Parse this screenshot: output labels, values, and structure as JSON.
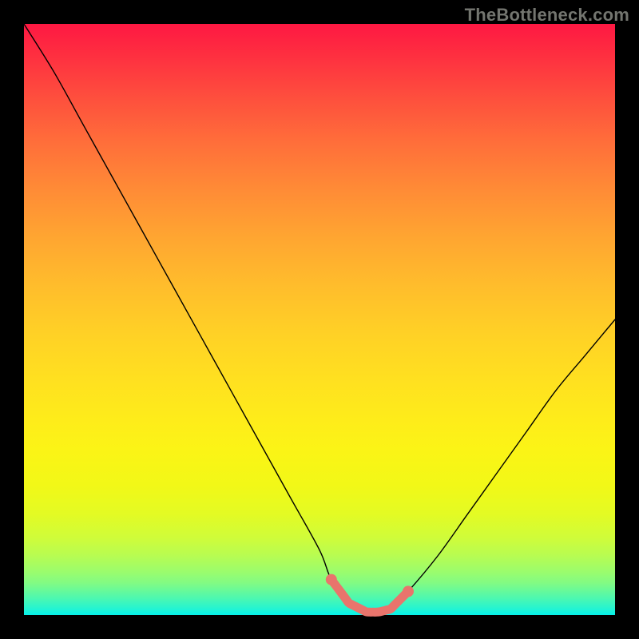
{
  "attribution": "TheBottleneck.com",
  "colors": {
    "frame": "#000000",
    "curve": "#000000",
    "accent": "#e9746c",
    "attribution_text": "#73756f"
  },
  "chart_data": {
    "type": "line",
    "title": "",
    "xlabel": "",
    "ylabel": "",
    "xlim": [
      0,
      100
    ],
    "ylim": [
      0,
      100
    ],
    "series": [
      {
        "name": "curve",
        "x": [
          0,
          5,
          10,
          15,
          20,
          25,
          30,
          35,
          40,
          45,
          50,
          52,
          55,
          58,
          60,
          62,
          65,
          70,
          75,
          80,
          85,
          90,
          95,
          100
        ],
        "values": [
          100,
          92,
          83,
          74,
          65,
          56,
          47,
          38,
          29,
          20,
          11,
          6,
          2,
          0.5,
          0.5,
          1,
          4,
          10,
          17,
          24,
          31,
          38,
          44,
          50
        ]
      }
    ],
    "accent_segment": {
      "x_start": 52,
      "x_end": 65,
      "note": "highlighted trough region near y≈0.5–4"
    },
    "gradient_background": {
      "direction": "vertical",
      "stops": [
        {
          "pos": 0.0,
          "color": "#fe1842"
        },
        {
          "pos": 0.2,
          "color": "#ff6e3a"
        },
        {
          "pos": 0.44,
          "color": "#ffbc2c"
        },
        {
          "pos": 0.67,
          "color": "#feec1a"
        },
        {
          "pos": 0.83,
          "color": "#e3fb24"
        },
        {
          "pos": 0.92,
          "color": "#9dfc6b"
        },
        {
          "pos": 1.0,
          "color": "#05f1eb"
        }
      ]
    }
  }
}
